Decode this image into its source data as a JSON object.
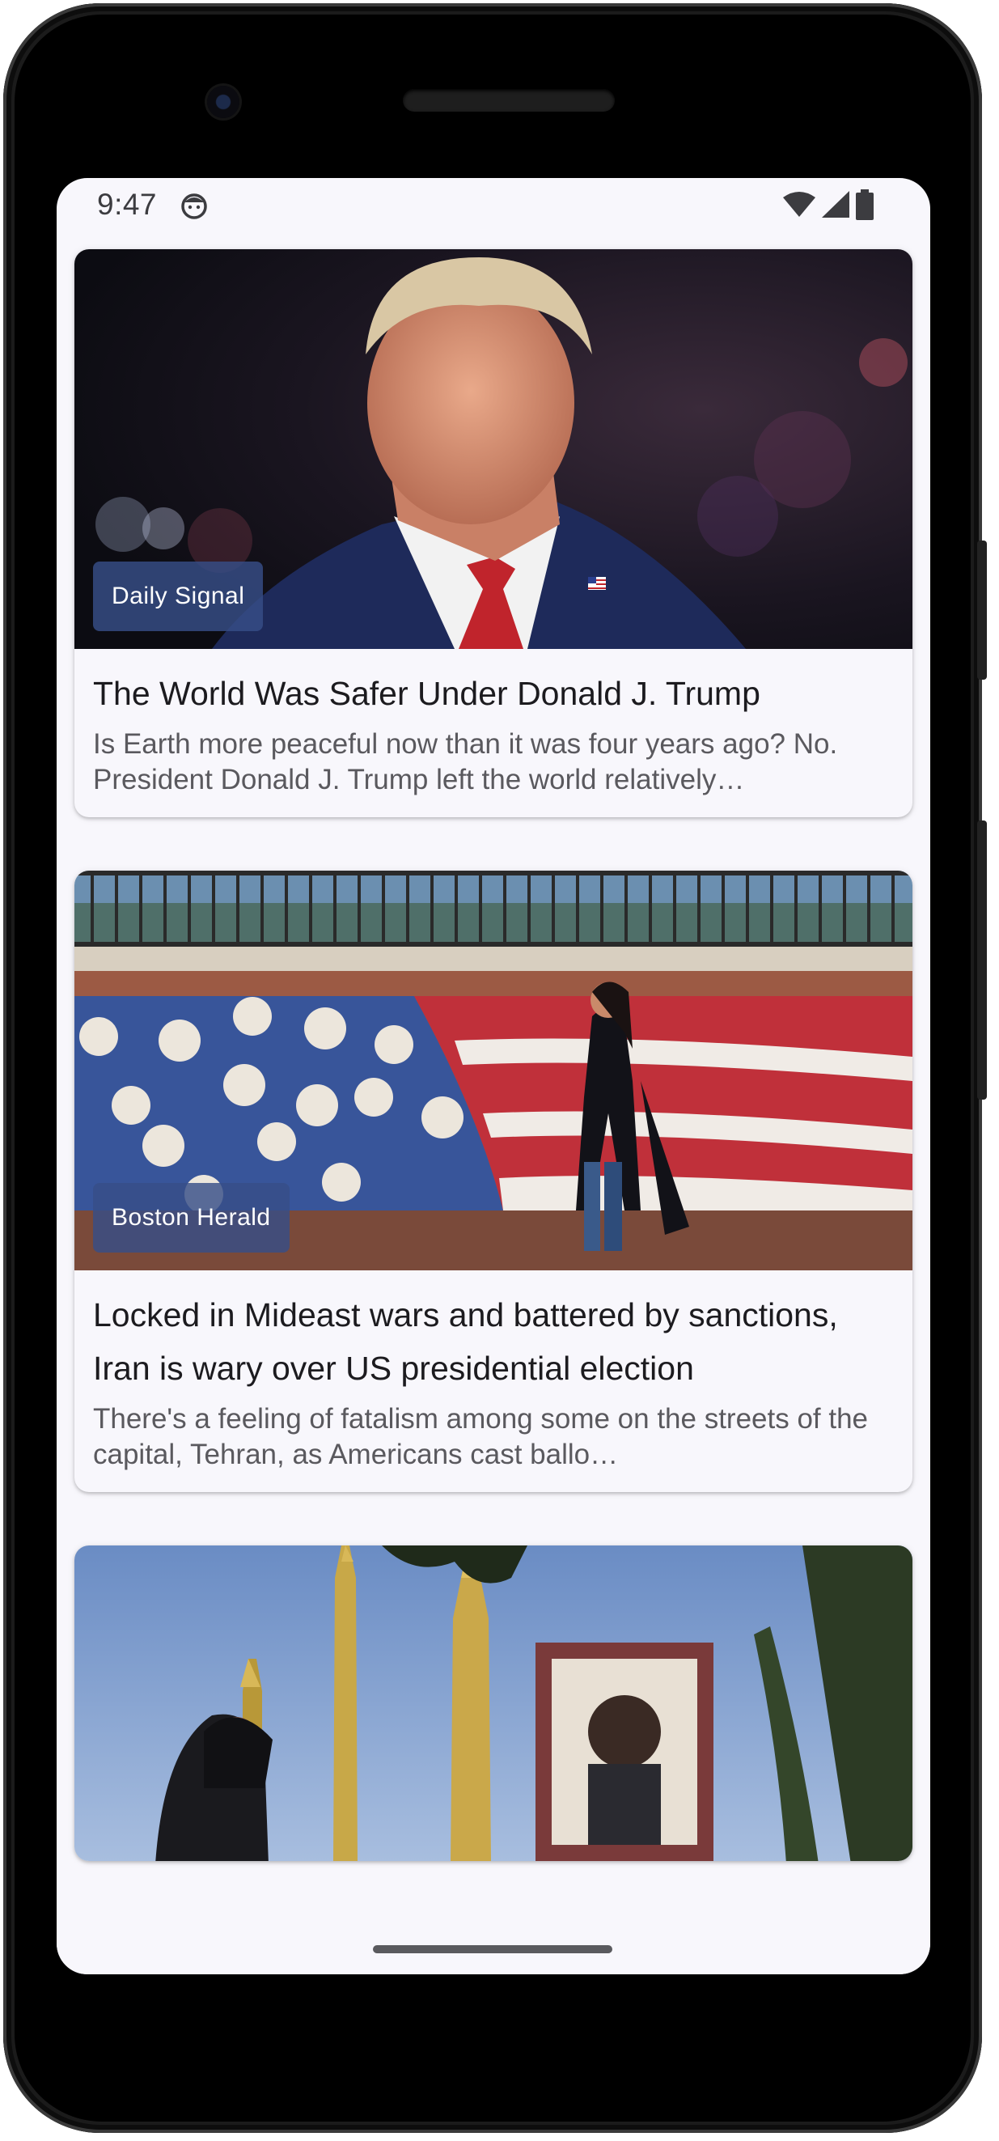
{
  "status_bar": {
    "time": "9:47",
    "icons": [
      "app-notification-icon",
      "wifi-icon",
      "cellular-signal-icon",
      "battery-icon"
    ]
  },
  "articles": [
    {
      "source": "Daily Signal",
      "title": "The World Was Safer Under Donald J. Trump",
      "description": "Is Earth more peaceful now than it was four years ago? No. President Donald J. Trump left the world relatively…"
    },
    {
      "source": "Boston Herald",
      "title": "Locked in Mideast wars and battered by sanctions, Iran is wary over US presidential election",
      "description": "There's a feeling of fatalism among some on the streets of the capital, Tehran, as Americans cast ballo…"
    },
    {
      "source": "",
      "title": "",
      "description": ""
    }
  ],
  "colors": {
    "screen_background": "#f8f7fc",
    "badge_background": "#374e87",
    "title_text": "#1c1b1f",
    "description_text": "#5a595e"
  }
}
